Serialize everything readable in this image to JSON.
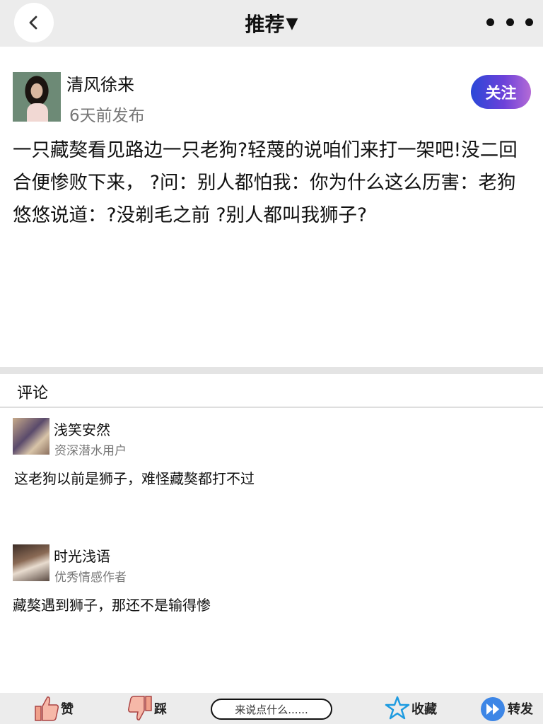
{
  "nav": {
    "title": "推荐",
    "caret": "▼"
  },
  "author": {
    "name": "清风徐来",
    "time": "6天前发布",
    "follow_label": "关注"
  },
  "post": {
    "text": "一只藏獒看见路边一只老狗?轻蔑的说咱们来打一架吧!没二回合便惨败下来， ?问：别人都怕我：你为什么这么历害：老狗悠悠说道：?没剃毛之前 ?别人都叫我狮子?"
  },
  "comments": {
    "title": "评论",
    "items": [
      {
        "name": "浅笑安然",
        "level": "资深潜水用户",
        "text": "这老狗以前是狮子，难怪藏獒都打不过"
      },
      {
        "name": "时光浅语",
        "level": "优秀情感作者",
        "text": "藏獒遇到狮子，那还不是输得惨"
      }
    ]
  },
  "bottom": {
    "like_label": "赞",
    "dislike_label": "踩",
    "input_placeholder": "来说点什么......",
    "favorite_label": "收藏",
    "share_label": "转发"
  },
  "colors": {
    "topbar_bg": "#ececec",
    "follow_gradient_start": "#2a48d8",
    "follow_gradient_end": "#b46bd6",
    "like_icon": "#f0a08a",
    "favorite_icon": "#1e9be0",
    "share_icon": "#3d86e6"
  },
  "icons": [
    "back-arrow-icon",
    "more-dots-icon",
    "thumbs-up-icon",
    "thumbs-down-icon",
    "star-icon",
    "forward-icon"
  ]
}
